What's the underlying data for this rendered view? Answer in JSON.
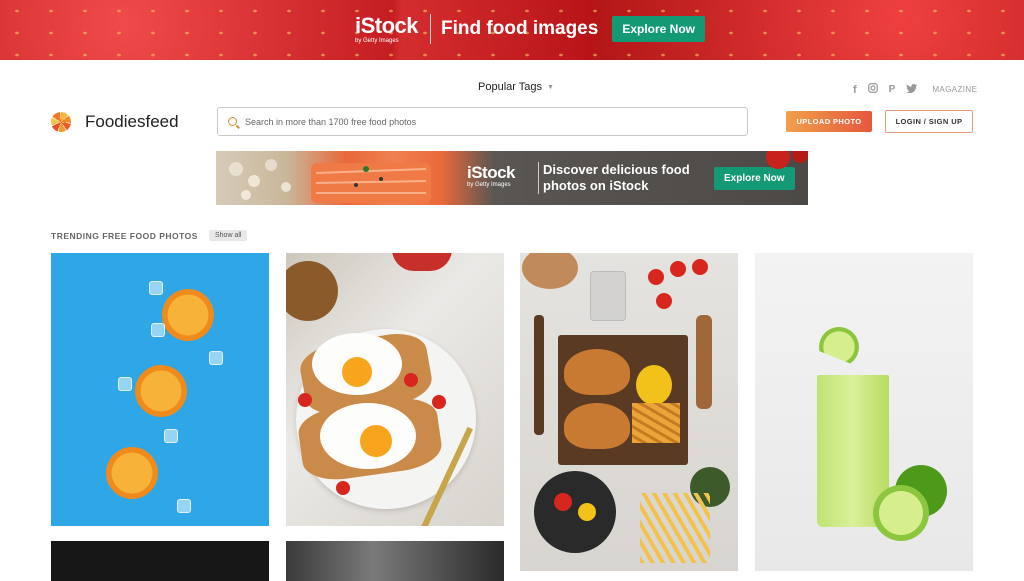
{
  "top_banner": {
    "brand": "iStock",
    "brand_sub": "by Getty Images",
    "tagline": "Find food images",
    "button": "Explore Now",
    "button_color": "#139a74"
  },
  "header": {
    "popular_tags": "Popular Tags",
    "social_icons": [
      "facebook-icon",
      "instagram-icon",
      "pinterest-icon",
      "twitter-icon"
    ],
    "magazine": "MAGAZINE",
    "logo_text": "Foodiesfeed",
    "search_placeholder": "Search in more than 1700 free food photos",
    "upload_button": "UPLOAD PHOTO",
    "login_button": "LOGIN / SIGN UP"
  },
  "ad_banner": {
    "brand": "iStock",
    "brand_sub": "by Getty Images",
    "text": "Discover delicious food photos on iStock",
    "button": "Explore Now"
  },
  "trending": {
    "title": "TRENDING FREE FOOD PHOTOS",
    "show_all": "Show all",
    "photos": [
      {
        "subject": "orange slices on blue background"
      },
      {
        "subject": "fried eggs on toast"
      },
      {
        "subject": "burgers with fries on board"
      },
      {
        "subject": "lime drink with limes"
      }
    ]
  }
}
